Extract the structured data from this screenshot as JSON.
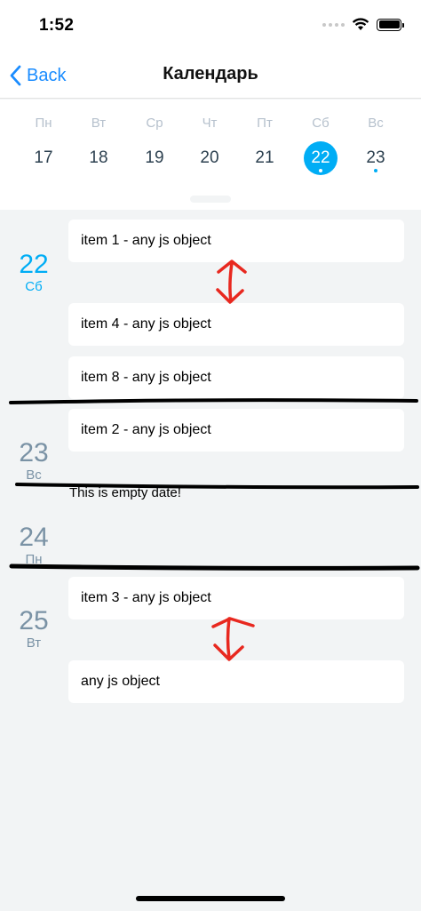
{
  "status_bar": {
    "time": "1:52"
  },
  "nav": {
    "back_label": "Back",
    "title": "Календарь"
  },
  "week": {
    "days": [
      {
        "name": "Пн",
        "num": "17",
        "selected": false,
        "dot": false
      },
      {
        "name": "Вт",
        "num": "18",
        "selected": false,
        "dot": false
      },
      {
        "name": "Ср",
        "num": "19",
        "selected": false,
        "dot": false
      },
      {
        "name": "Чт",
        "num": "20",
        "selected": false,
        "dot": false
      },
      {
        "name": "Пт",
        "num": "21",
        "selected": false,
        "dot": false
      },
      {
        "name": "Сб",
        "num": "22",
        "selected": true,
        "dot": true
      },
      {
        "name": "Вс",
        "num": "23",
        "selected": false,
        "dot": true
      }
    ]
  },
  "agenda": {
    "dates": [
      {
        "num": "22",
        "weekday": "Сб",
        "today": true
      },
      {
        "num": "23",
        "weekday": "Вс",
        "today": false
      },
      {
        "num": "24",
        "weekday": "Пн",
        "today": false
      },
      {
        "num": "25",
        "weekday": "Вт",
        "today": false
      }
    ],
    "items": [
      "item 1 - any js object",
      "item 4 - any js object",
      "item 8 - any js object",
      "item 2 - any js object",
      "item 3 - any js object",
      "any js object"
    ],
    "empty_text": "This is empty date!"
  },
  "colors": {
    "accent": "#00adf5",
    "back": "#1a8cff",
    "annotation_red": "#e8281f",
    "annotation_black": "#000000"
  }
}
